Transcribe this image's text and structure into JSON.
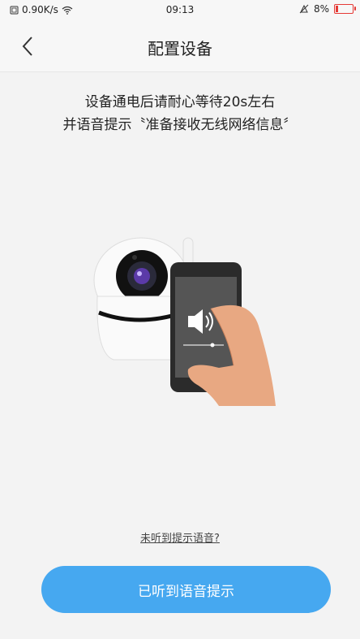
{
  "status_bar": {
    "network_speed": "0.90K/s",
    "time": "09:13",
    "battery": "8%"
  },
  "nav": {
    "title": "配置设备"
  },
  "instruction": {
    "line1": "设备通电后请耐心等待20s左右",
    "line2": "并语音提示〝准备接收无线网络信息〞"
  },
  "help_link": "未听到提示语音?",
  "confirm_button": "已听到语音提示",
  "colors": {
    "accent": "#46a8f0",
    "background": "#f3f3f3",
    "battery_low": "#e53935"
  }
}
